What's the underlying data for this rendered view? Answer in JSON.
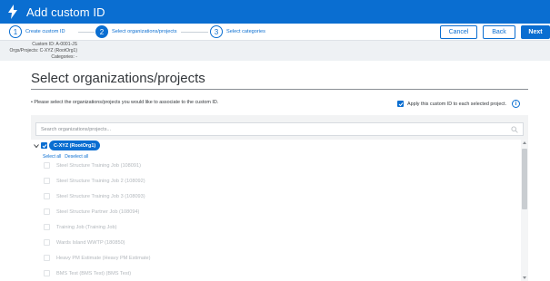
{
  "header": {
    "title": "Add custom ID"
  },
  "steps": [
    {
      "num": "1",
      "label": "Create custom ID"
    },
    {
      "num": "2",
      "label": "Select organizations/projects"
    },
    {
      "num": "3",
      "label": "Select categories"
    }
  ],
  "actions": {
    "cancel": "Cancel",
    "back": "Back",
    "next": "Next"
  },
  "info": {
    "custom_id": "Custom ID: A-0001-JS",
    "orgs": "Orgs/Projects: C-XYZ (RootOrg1)",
    "categories": "Categories: -"
  },
  "main": {
    "heading": "Select organizations/projects",
    "instruction": "• Please select the organizations/projects you would like to associate to the custom ID.",
    "apply_label": "Apply this custom ID to each selected project.",
    "info_icon": "i"
  },
  "search": {
    "placeholder": "Search organizations/projects..."
  },
  "tree": {
    "root_label": "C-XYZ (RootOrg1)",
    "select_all": "Select all",
    "deselect_all": "Deselect all",
    "items": [
      "Steel Structure Training Job (108091)",
      "Steel Structure Training Job 2 (108092)",
      "Steel Structure Training Job 3 (108093)",
      "Steel Structure Partner Job (108094)",
      "Training Job (Training Job)",
      "Wards Island WWTP (180850)",
      "Heavy PM Estimate (Heavy PM Estimate)",
      "BMS Test (BMS Test) (BMS Test)"
    ]
  },
  "colors": {
    "accent": "#0a6ed1",
    "info_bg": "#eef1f4",
    "disabled_text": "#b3b8bd"
  },
  "icons": [
    "bolt-icon",
    "search-icon",
    "chevron-down-icon",
    "info-icon",
    "check-icon"
  ]
}
